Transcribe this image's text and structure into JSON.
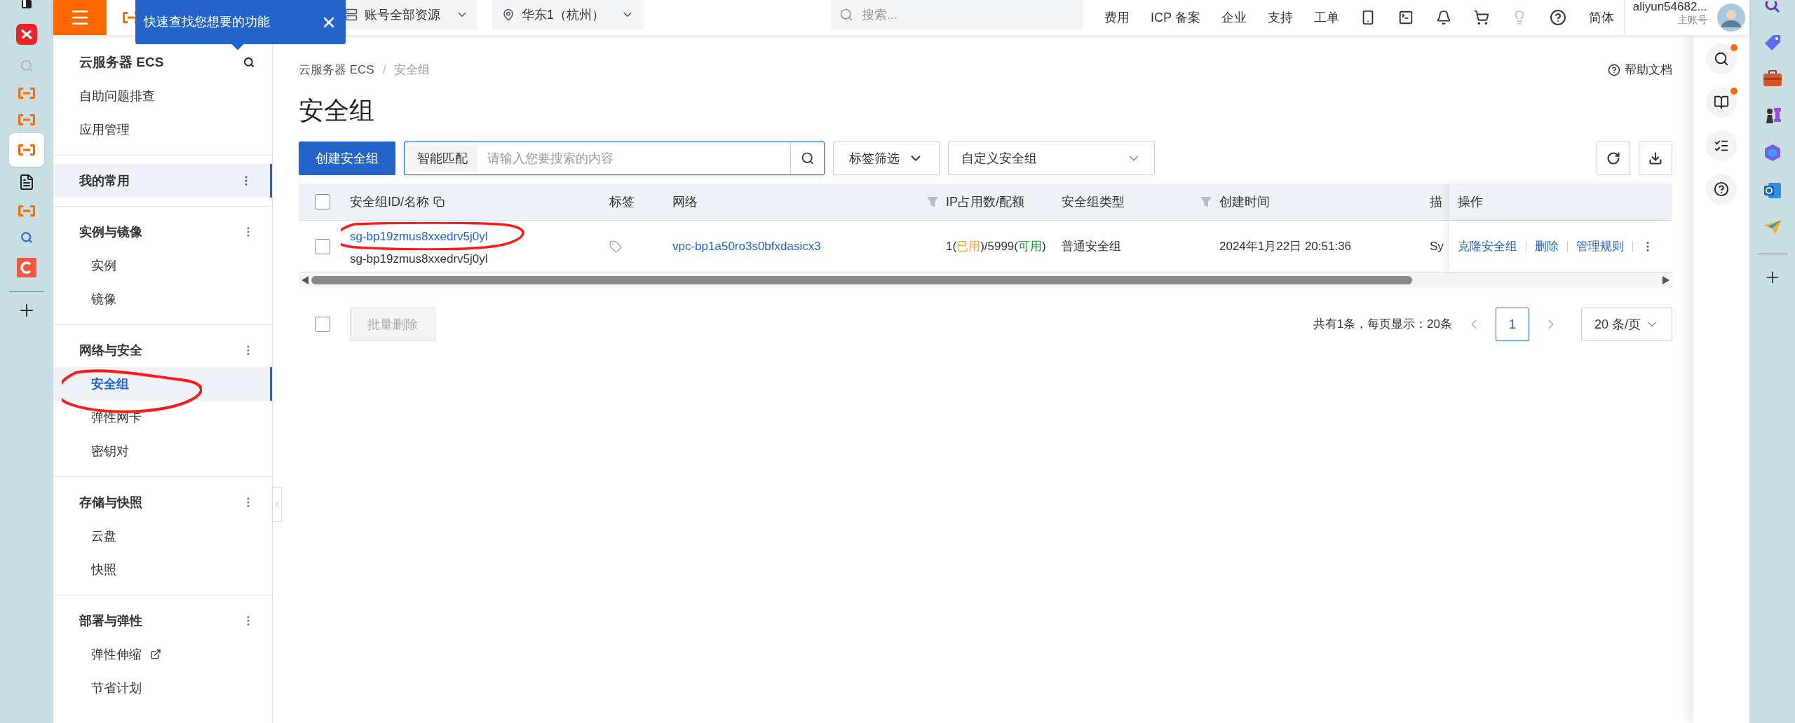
{
  "topbar": {
    "tooltip": {
      "text": "快速查找您想要的功能"
    },
    "resource_selector": "账号全部资源",
    "region_selector": "华东1（杭州）",
    "search": {
      "placeholder": "搜索..."
    },
    "links": [
      "费用",
      "ICP 备案",
      "企业",
      "支持",
      "工单"
    ],
    "language": "简体",
    "account": {
      "name": "aliyun54682...",
      "role": "主账号"
    }
  },
  "sidebar": {
    "title": "云服务器 ECS",
    "links": [
      {
        "label": "自助问题排查"
      },
      {
        "label": "应用管理"
      }
    ],
    "groups": [
      {
        "label": "我的常用",
        "selected": true
      },
      {
        "label": "实例与镜像",
        "selected": false,
        "children": [
          {
            "label": "实例",
            "selected": false,
            "external": false
          },
          {
            "label": "镜像",
            "selected": false,
            "external": false
          }
        ]
      },
      {
        "label": "网络与安全",
        "selected": false,
        "children": [
          {
            "label": "安全组",
            "selected": true,
            "external": false
          },
          {
            "label": "弹性网卡",
            "selected": false,
            "external": false
          },
          {
            "label": "密钥对",
            "selected": false,
            "external": false
          }
        ]
      },
      {
        "label": "存储与快照",
        "selected": false,
        "children": [
          {
            "label": "云盘",
            "selected": false,
            "external": false
          },
          {
            "label": "快照",
            "selected": false,
            "external": false
          }
        ]
      },
      {
        "label": "部署与弹性",
        "selected": false,
        "children": [
          {
            "label": "弹性伸缩",
            "selected": false,
            "external": true
          },
          {
            "label": "节省计划",
            "selected": false,
            "external": false
          }
        ]
      }
    ]
  },
  "page": {
    "breadcrumb": [
      "云服务器 ECS",
      "安全组"
    ],
    "breadcrumb_separator": "/",
    "help": "帮助文档",
    "title": "安全组",
    "toolbar": {
      "create_button": "创建安全组",
      "search": {
        "mode": "智能匹配",
        "placeholder": "请输入您要搜索的内容"
      },
      "tag_filter": "标签筛选",
      "view_select": "自定义安全组"
    },
    "table": {
      "all_checked": false,
      "columns": [
        {
          "label": "安全组ID/名称",
          "kind": "copyable"
        },
        {
          "label": "标签",
          "kind": "plain"
        },
        {
          "label": "网络",
          "kind": "filterable"
        },
        {
          "label": "IP占用数/配额",
          "kind": "plain"
        },
        {
          "label": "安全组类型",
          "kind": "filterable"
        },
        {
          "label": "创建时间",
          "kind": "plain"
        },
        {
          "label": "描",
          "kind": "plain"
        },
        {
          "label": "操作",
          "kind": "plain"
        }
      ],
      "rows": [
        {
          "selected": false,
          "id": "sg-bp19zmus8xxedrv5j0yl",
          "name": "sg-bp19zmus8xxedrv5j0yl",
          "network": "vpc-bp1a50ro3s0bfxdasicx3",
          "ip_usage": [
            {
              "text": "1("
            },
            {
              "text": "已用",
              "color": "#e6a23c"
            },
            {
              "text": ")/5999("
            },
            {
              "text": "可用",
              "color": "#1a8f2e"
            },
            {
              "text": ")"
            }
          ],
          "type": "普通安全组",
          "created": "2024年1月22日 20:51:36",
          "column_7": "Sy",
          "actions": [
            "克隆安全组",
            "删除",
            "管理规则"
          ]
        }
      ]
    },
    "footer": {
      "all_checked": false,
      "bulk_delete": {
        "label": "批量删除",
        "disabled": true
      },
      "summary": "共有1条，每页显示：20条",
      "pages": [
        {
          "label": "1",
          "selected": true
        }
      ],
      "page_size": "20 条/页"
    }
  }
}
